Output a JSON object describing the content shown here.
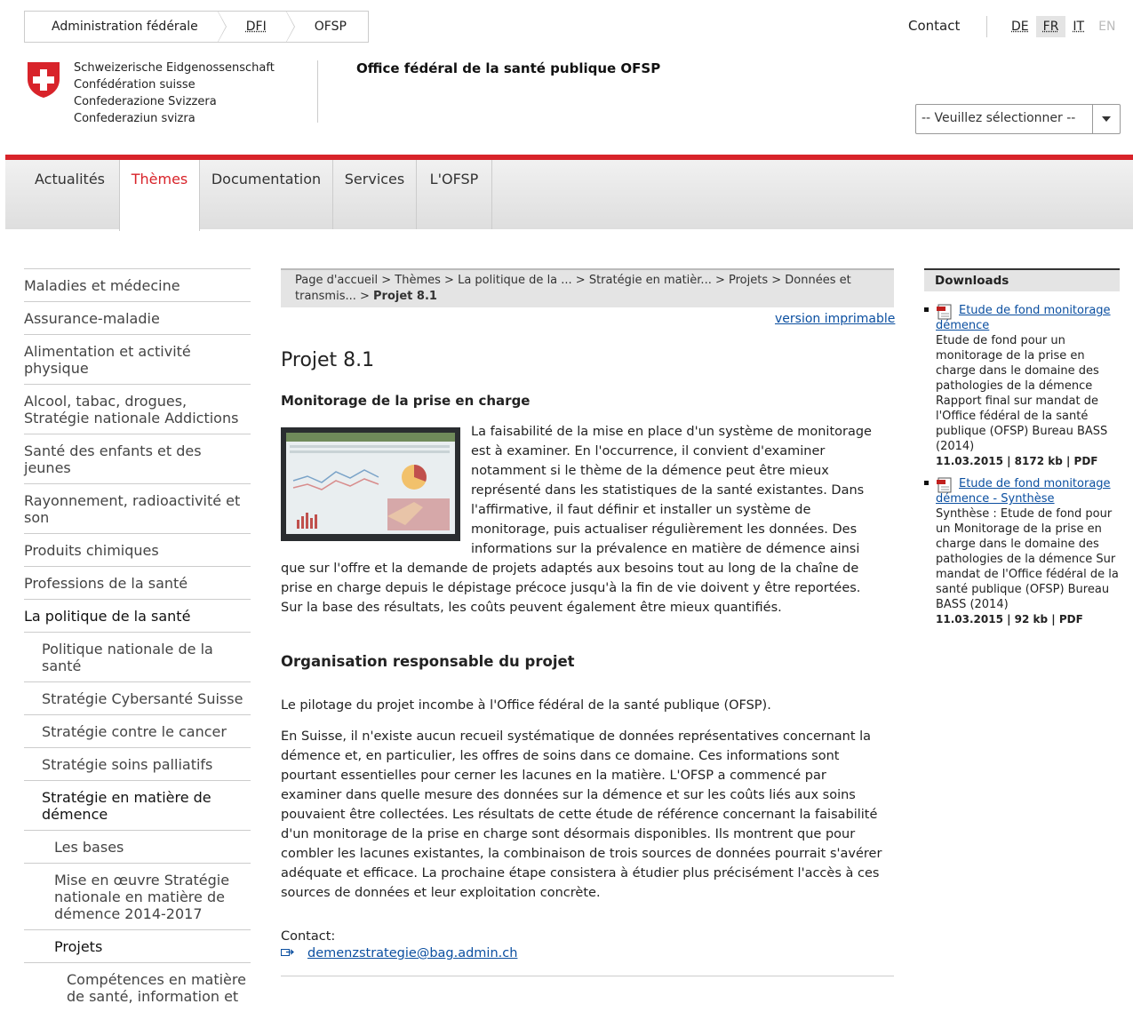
{
  "top_breadcrumb": [
    "Administration fédérale",
    "DFI",
    "OFSP"
  ],
  "header": {
    "contact": "Contact",
    "languages": [
      {
        "code": "DE",
        "state": "link"
      },
      {
        "code": "FR",
        "state": "active"
      },
      {
        "code": "IT",
        "state": "link"
      },
      {
        "code": "EN",
        "state": "disabled"
      }
    ],
    "federation_names": [
      "Schweizerische Eidgenossenschaft",
      "Confédération suisse",
      "Confederazione Svizzera",
      "Confederaziun svizra"
    ],
    "office_title": "Office fédéral de la santé publique OFSP",
    "select_placeholder": "-- Veuillez sélectionner --"
  },
  "nav": {
    "items": [
      "Actualités",
      "Thèmes",
      "Documentation",
      "Services",
      "L'OFSP"
    ],
    "active": "Thèmes"
  },
  "sidebar": [
    {
      "label": "Maladies et médecine",
      "level": 0
    },
    {
      "label": "Assurance-maladie",
      "level": 0
    },
    {
      "label": "Alimentation et activité physique",
      "level": 0
    },
    {
      "label": "Alcool, tabac, drogues, Stratégie nationale Addictions",
      "level": 0
    },
    {
      "label": "Santé des enfants et des jeunes",
      "level": 0
    },
    {
      "label": "Rayonnement, radioactivité et son",
      "level": 0
    },
    {
      "label": "Produits chimiques",
      "level": 0
    },
    {
      "label": "Professions de la santé",
      "level": 0
    },
    {
      "label": "La politique de la santé",
      "level": 0,
      "current": true
    },
    {
      "label": "Politique nationale de la santé",
      "level": 1
    },
    {
      "label": "Stratégie Cybersanté Suisse",
      "level": 1
    },
    {
      "label": "Stratégie contre le cancer",
      "level": 1
    },
    {
      "label": "Stratégie soins palliatifs",
      "level": 1
    },
    {
      "label": "Stratégie en matière de démence",
      "level": 1,
      "current": true
    },
    {
      "label": "Les bases",
      "level": 2
    },
    {
      "label": "Mise en œuvre Stratégie nationale en matière de démence 2014-2017",
      "level": 2
    },
    {
      "label": "Projets",
      "level": 2,
      "current": true
    },
    {
      "label": "Compétences en matière de santé, information et",
      "level": 3
    }
  ],
  "content": {
    "breadcrumb_text": "Page d'accueil > Thèmes > La politique de la ... > Stratégie en matièr... > Projets > Données et transmis... > ",
    "breadcrumb_current": "Projet 8.1",
    "print_link": "version imprimable",
    "title": "Projet 8.1",
    "subtitle": "Monitorage de la prise en charge",
    "para1": "La faisabilité de la mise en place d'un système de monitorage est à examiner. En l'occurrence, il convient d'examiner notamment si le thème de la démence peut être mieux représenté dans les statistiques de la santé existantes. Dans l'affirmative, il faut définir et installer un système de monitorage, puis actualiser régulièrement les données. Des informations sur la prévalence en matière de démence ainsi que sur l'offre et la demande de projets adaptés aux besoins tout au long de la chaîne de prise en charge depuis le dépistage précoce jusqu'à la fin de vie doivent y être reportées. Sur la base des résultats, les coûts peuvent également être mieux quantifiés.",
    "org_heading": "Organisation responsable du projet",
    "para2": "Le pilotage du projet incombe à l'Office fédéral de la santé publique (OFSP).",
    "para3": "En Suisse, il n'existe aucun recueil systématique de données représentatives concernant la démence et, en particulier, les offres de soins dans ce domaine. Ces informations sont pourtant essentielles pour cerner les lacunes en la matière. L'OFSP a commencé par examiner dans quelle mesure des données sur la démence et sur les coûts liés aux soins pouvaient être collectées. Les résultats de cette étude de référence concernant la faisabilité d'un monitorage de la prise en charge sont désormais disponibles. Ils montrent que pour combler les lacunes existantes, la combinaison de trois sources de données pourrait s'avérer adéquate et efficace. La prochaine étape consistera à étudier plus précisément l'accès à ces sources de données et leur exploitation concrète.",
    "contact_label": "Contact:",
    "contact_email": "demenzstrategie@bag.admin.ch"
  },
  "downloads": {
    "heading": "Downloads",
    "items": [
      {
        "link": "Etude de fond monitorage démence",
        "description": "Etude de fond pour un monitorage de la prise en charge dans le domaine des pathologies de la démence Rapport final sur mandat de l'Office fédéral de la santé publique (OFSP) Bureau BASS (2014)",
        "meta": "11.03.2015 | 8172 kb | PDF"
      },
      {
        "link": "Etude de fond monitorage démence - Synthèse",
        "description": "Synthèse : Etude de fond pour un Monitorage de la prise en charge dans le domaine des pathologies de la démence Sur mandat de l'Office fédéral de la santé publique (OFSP) Bureau BASS (2014)",
        "meta": "11.03.2015 | 92 kb | PDF"
      }
    ]
  },
  "colors": {
    "accent_red": "#d8232a",
    "link_blue": "#0b4fa0",
    "bar_gray": "#e4e4e4"
  }
}
